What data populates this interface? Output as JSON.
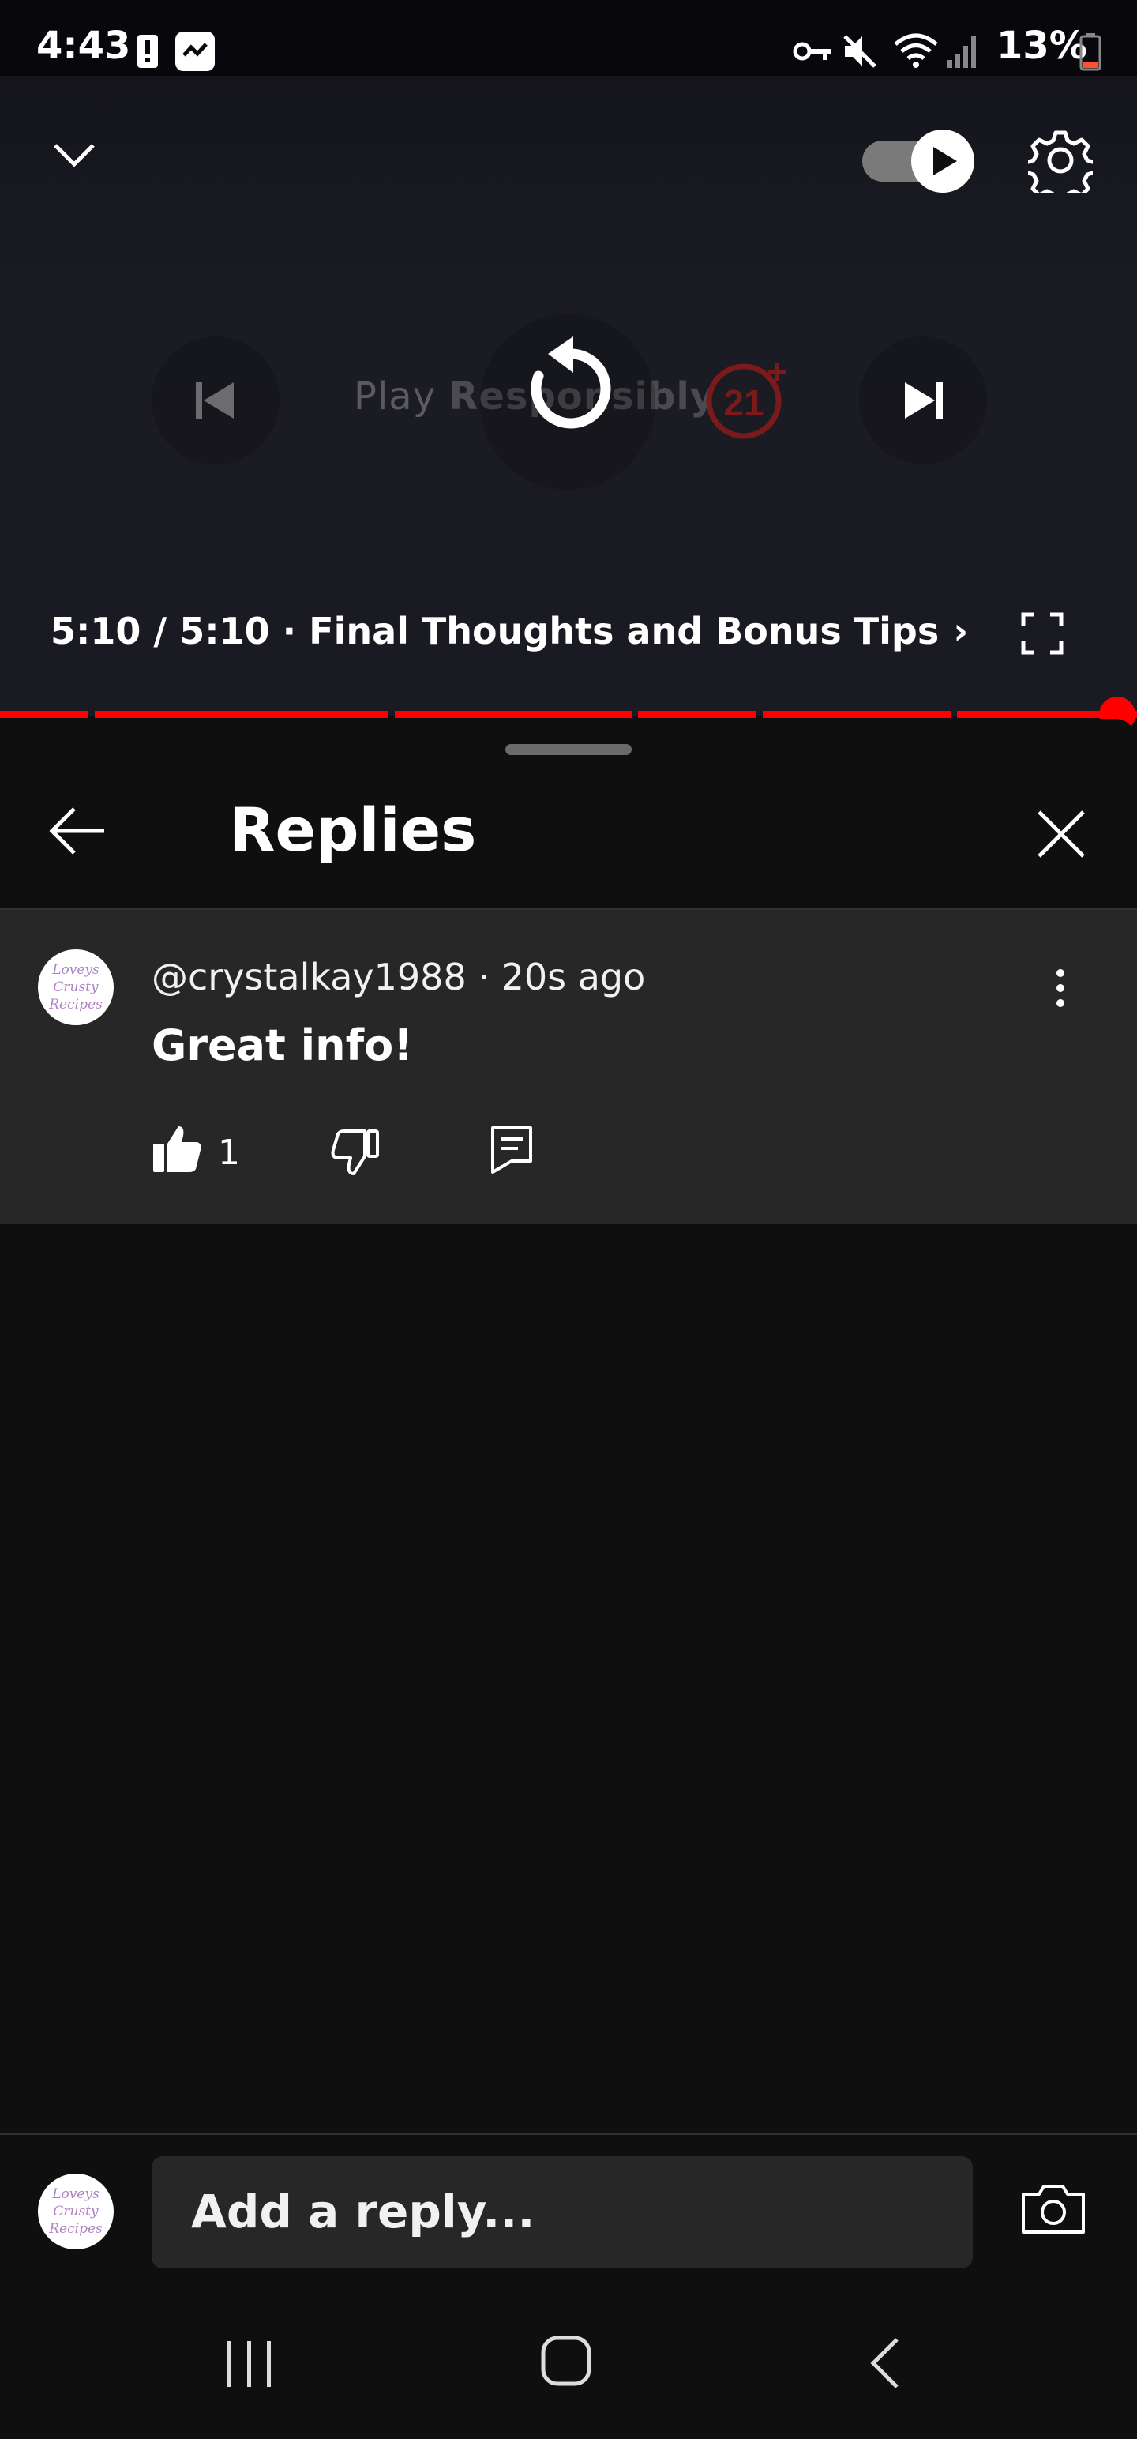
{
  "status_bar": {
    "time": "4:43",
    "battery_percent": "13%",
    "icons": [
      "alert-icon",
      "app-notification-icon",
      "vpn-key-icon",
      "mute-icon",
      "wifi-icon",
      "signal-icon",
      "battery-icon"
    ]
  },
  "player": {
    "watermark_prefix": "Play ",
    "watermark_bold": "Responsibly",
    "watermark_badge": "21",
    "time_display": "5:10 / 5:10 · Final Thoughts and Bonus Tips",
    "progress_percent": 100,
    "autoplay_on": true,
    "icons": [
      "collapse-chevron-icon",
      "autoplay-toggle",
      "settings-icon",
      "previous-icon",
      "replay-icon",
      "next-icon",
      "fullscreen-icon"
    ]
  },
  "sheet": {
    "title": "Replies"
  },
  "comment": {
    "avatar_text": [
      "Loveys",
      "Crusty",
      "Recipes"
    ],
    "meta": "@crystalkay1988 · 20s ago",
    "text": "Great info!",
    "likes": "1"
  },
  "reply_input": {
    "placeholder": "Add a reply...",
    "avatar_text": [
      "Loveys",
      "Crusty",
      "Recipes"
    ]
  },
  "colors": {
    "accent_red": "#ff0000",
    "background": "#0f0f0f",
    "card": "#272727"
  }
}
